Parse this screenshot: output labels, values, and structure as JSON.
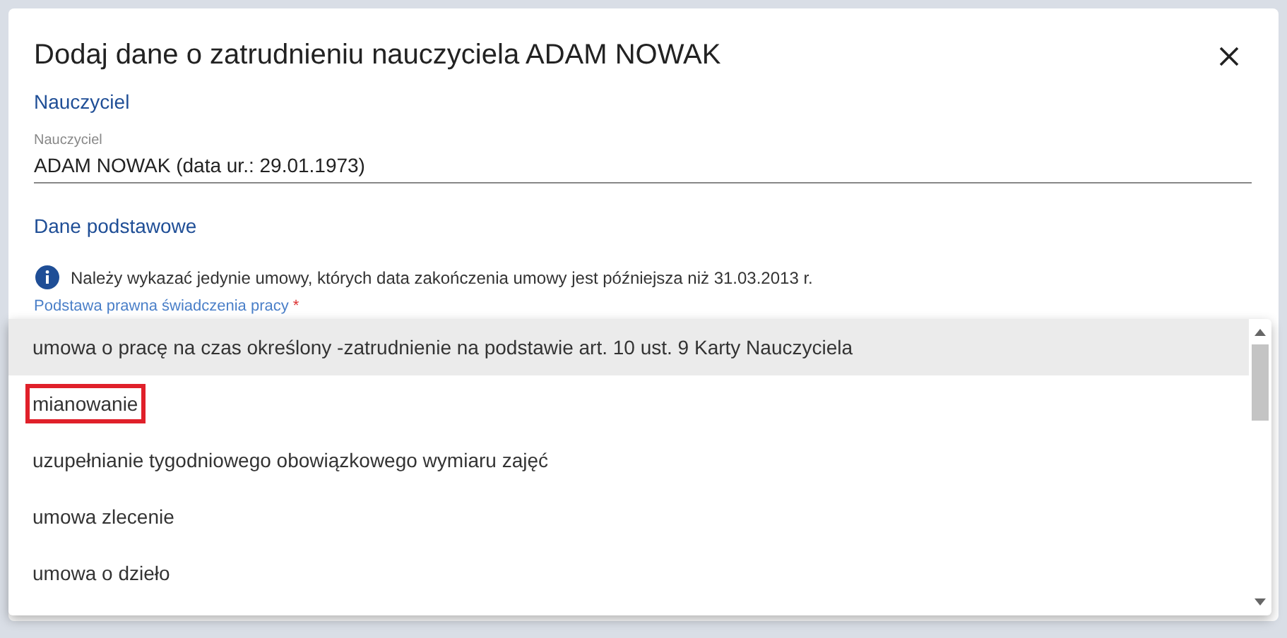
{
  "dialog": {
    "title": "Dodaj dane o zatrudnieniu nauczyciela ADAM NOWAK",
    "sections": [
      {
        "heading": "Nauczyciel"
      }
    ],
    "teacher_field": {
      "label": "Nauczyciel",
      "value": "ADAM NOWAK (data ur.: 29.01.1973)"
    },
    "basic_heading": "Dane podstawowe",
    "info": "Należy wykazać jedynie umowy, których data zakończenia umowy jest późniejsza niż 31.03.2013 r.",
    "legal_basis_label": "Podstawa prawna świadczenia pracy",
    "required_mark": "*"
  },
  "dropdown": {
    "options": [
      {
        "label": "umowa o pracę na czas określony -zatrudnienie na podstawie art. 10 ust. 9 Karty Nauczyciela",
        "selected": true,
        "marked": false
      },
      {
        "label": "mianowanie",
        "selected": false,
        "marked": true
      },
      {
        "label": "uzupełnianie tygodniowego obowiązkowego wymiaru zajęć",
        "selected": false,
        "marked": false
      },
      {
        "label": "umowa zlecenie",
        "selected": false,
        "marked": false
      },
      {
        "label": "umowa o dzieło",
        "selected": false,
        "marked": false
      }
    ]
  }
}
